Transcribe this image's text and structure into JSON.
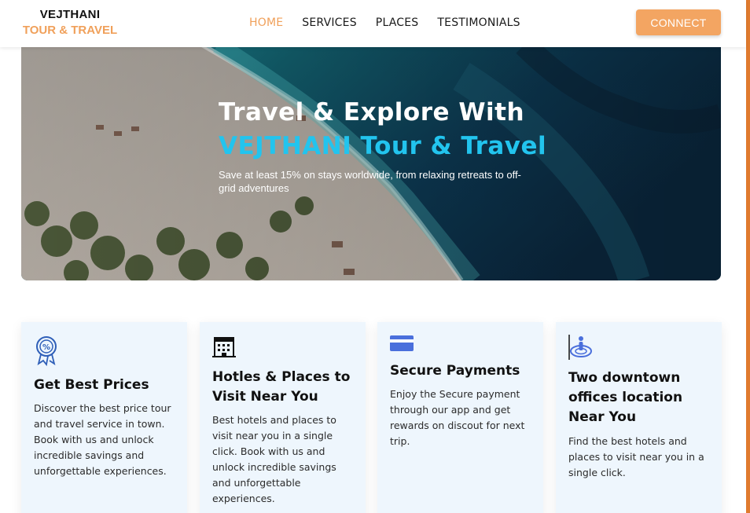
{
  "brand": {
    "line1": "VEJTHANI",
    "line2": "TOUR & TRAVEL"
  },
  "nav": {
    "items": [
      {
        "label": "HOME",
        "active": true
      },
      {
        "label": "SERVICES",
        "active": false
      },
      {
        "label": "PLACES",
        "active": false
      },
      {
        "label": "TESTIMONIALS",
        "active": false
      }
    ],
    "connect_label": "CONNECT"
  },
  "hero": {
    "title": "Travel & Explore With",
    "brand": "VEJTHANI Tour & Travel",
    "subtitle": "Save at least 15% on stays worldwide, from relaxing retreats to off-grid adventures"
  },
  "features": [
    {
      "icon": "discount-badge-icon",
      "title": "Get Best Prices",
      "text": "Discover the best price tour and travel service in town. Book with us and unlock incredible savings and unforgettable experiences."
    },
    {
      "icon": "hotel-building-icon",
      "title": "Hotles & Places to Visit Near You",
      "text": "Best hotels and places to visit near you in a single click. Book with us and unlock incredible savings and unforgettable experiences."
    },
    {
      "icon": "credit-card-icon",
      "title": "Secure Payments",
      "text": "Enjoy the Secure payment through our app and get rewards on discout for next trip."
    },
    {
      "icon": "location-person-icon",
      "title": "Two downtown offices location Near You",
      "text": "Find the best hotels and places to visit near you in a single click."
    }
  ],
  "colors": {
    "accent": "#f0a05a",
    "button": "#f3a562",
    "hero_brand": "#22c4ee",
    "card_bg": "#eef6fd",
    "scroll_accent": "#e07a2e"
  }
}
